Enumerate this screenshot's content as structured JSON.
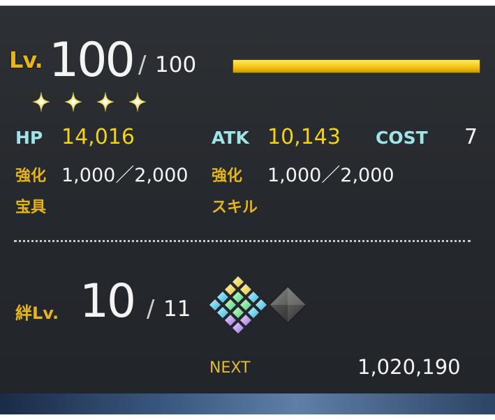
{
  "level": {
    "label": "Lv.",
    "current": "100",
    "separator": "/",
    "max": "100",
    "bar_fill_fraction": 1.0
  },
  "rarity": {
    "stars": 4,
    "icon": "sparkle-star-icon"
  },
  "stats": {
    "hp_label": "HP",
    "hp_value": "14,016",
    "atk_label": "ATK",
    "atk_value": "10,143",
    "cost_label": "COST",
    "cost_value": "7"
  },
  "enhancement": {
    "hp_label": "強化",
    "hp_value": "1,000／2,000",
    "atk_label": "強化",
    "atk_value": "1,000／2,000"
  },
  "sections": {
    "noble_phantasm": "宝具",
    "skill": "スキル"
  },
  "bond": {
    "label": "絆Lv.",
    "current": "10",
    "separator": "/",
    "max": "11",
    "icons": [
      "bond-crystal-rainbow-icon",
      "bond-crystal-dark-icon"
    ]
  },
  "next": {
    "label": "NEXT",
    "value": "1,020,190"
  },
  "colors": {
    "label_gold": "#e6b41c",
    "value_yellow": "#f3d21a",
    "label_teal": "#9fe4e8",
    "bar_fill": "#f2c20f",
    "panel_bg": "#2a2d31"
  }
}
